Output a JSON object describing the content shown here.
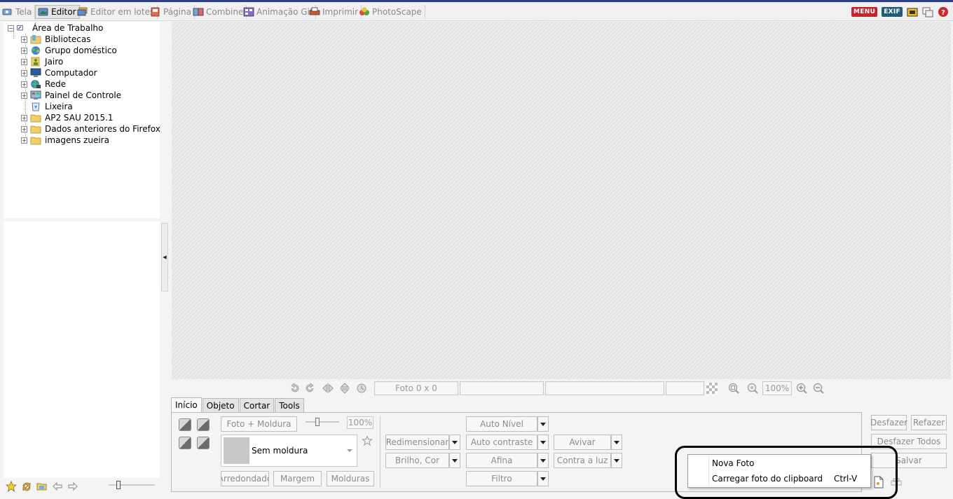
{
  "tabs": [
    {
      "label": "Tela",
      "active": false
    },
    {
      "label": "Editor",
      "active": true
    },
    {
      "label": "Editor em lotes",
      "active": false
    },
    {
      "label": "Página",
      "active": false
    },
    {
      "label": "Combine",
      "active": false
    },
    {
      "label": "Animação Gif",
      "active": false
    },
    {
      "label": "Imprimir",
      "active": false
    },
    {
      "label": "PhotoScape",
      "active": false
    }
  ],
  "header_right": {
    "menu_label": "MENU",
    "exif_label": "EXIF"
  },
  "tree": {
    "root": "Área de Trabalho",
    "items": [
      {
        "label": "Bibliotecas",
        "icon": "libraries-icon",
        "expandable": true
      },
      {
        "label": "Grupo doméstico",
        "icon": "homegroup-icon",
        "expandable": true
      },
      {
        "label": "Jairo",
        "icon": "user-folder-icon",
        "expandable": true
      },
      {
        "label": "Computador",
        "icon": "computer-icon",
        "expandable": true
      },
      {
        "label": "Rede",
        "icon": "network-icon",
        "expandable": true
      },
      {
        "label": "Painel de Controle",
        "icon": "control-panel-icon",
        "expandable": true
      },
      {
        "label": "Lixeira",
        "icon": "recycle-bin-icon",
        "expandable": false
      },
      {
        "label": "AP2 SAU 2015.1",
        "icon": "folder-icon",
        "expandable": true
      },
      {
        "label": "Dados anteriores do Firefox",
        "icon": "folder-icon",
        "expandable": true
      },
      {
        "label": "imagens zueira",
        "icon": "folder-icon",
        "expandable": true
      }
    ]
  },
  "toolbar": {
    "photo_size": "Foto 0 x 0",
    "zoom": "100%"
  },
  "panel_tabs": [
    "Início",
    "Objeto",
    "Cortar",
    "Tools"
  ],
  "panel": {
    "photo_frame": "Foto + Moldura",
    "opacity": "100%",
    "frame_name": "Sem moldura",
    "rounded": "Arredondado",
    "margin": "Margem",
    "frames": "Molduras",
    "resize": "Redimensionar",
    "brightness": "Brilho, Cor",
    "auto_level": "Auto Nível",
    "auto_contrast": "Auto contraste",
    "sharpen": "Afina",
    "filter": "Filtro",
    "vivid": "Avivar",
    "backlight": "Contra a luz"
  },
  "right_buttons": {
    "undo": "Desfazer",
    "redo": "Refazer",
    "undo_all": "Desfazer Todos",
    "save": "Salvar"
  },
  "context_menu": {
    "items": [
      {
        "label": "Nova Foto",
        "shortcut": ""
      },
      {
        "label": "Carregar foto do clipboard",
        "shortcut": "Ctrl-V"
      }
    ]
  }
}
